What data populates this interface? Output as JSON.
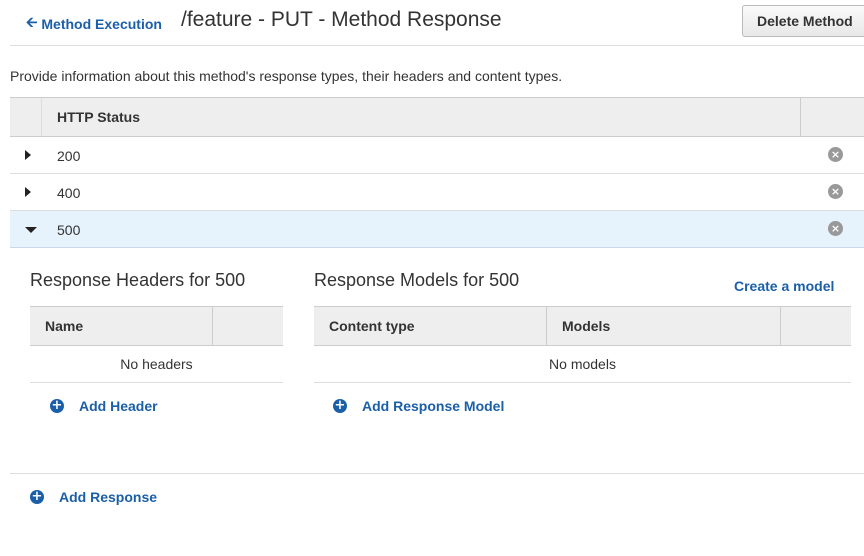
{
  "header": {
    "back_label": "Method Execution",
    "title": "/feature - PUT - Method Response",
    "delete_label": "Delete Method"
  },
  "description": "Provide information about this method's response types, their headers and content types.",
  "status_table": {
    "header": "HTTP Status",
    "rows": [
      {
        "code": "200",
        "expanded": false
      },
      {
        "code": "400",
        "expanded": false
      },
      {
        "code": "500",
        "expanded": true
      }
    ]
  },
  "headers_section": {
    "title": "Response Headers for 500",
    "column": "Name",
    "empty": "No headers",
    "add_label": "Add Header"
  },
  "models_section": {
    "title": "Response Models for 500",
    "create_label": "Create a model",
    "columns": [
      "Content type",
      "Models"
    ],
    "empty": "No models",
    "add_label": "Add Response Model"
  },
  "add_response_label": "Add Response",
  "colors": {
    "link": "#1a5fa8",
    "header_bg": "#eeeeee",
    "selected_row_bg": "#e6f2fc"
  }
}
